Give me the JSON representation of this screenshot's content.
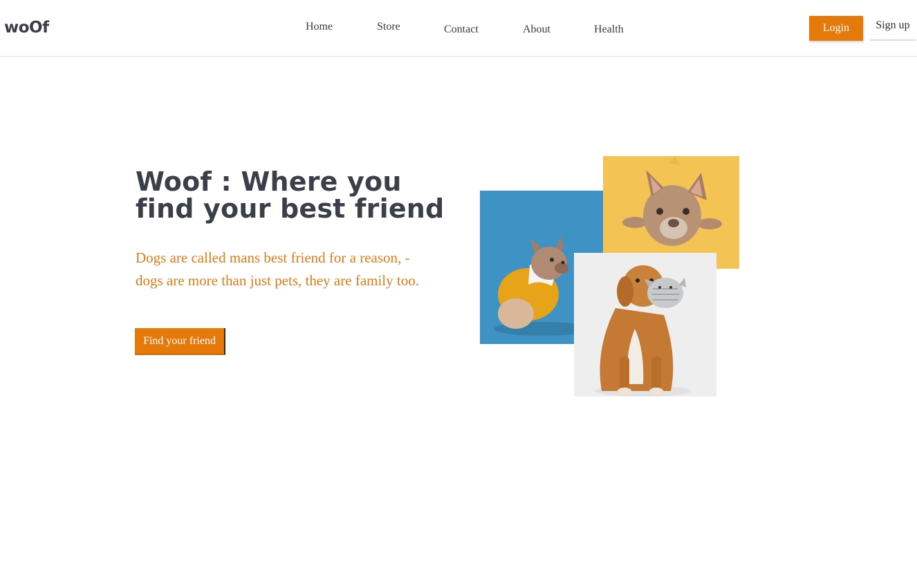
{
  "brand": {
    "logo_text": "woOf"
  },
  "nav": {
    "items": [
      {
        "label": "Home"
      },
      {
        "label": "Store"
      },
      {
        "label": "Contact"
      },
      {
        "label": "About"
      },
      {
        "label": "Health"
      }
    ]
  },
  "auth": {
    "login_label": "Login",
    "signup_label": "Sign up"
  },
  "hero": {
    "title": "Woof : Where you find your best friend",
    "description": "Dogs are called mans best friend for a reason, - dogs are more than just pets, they are family too.",
    "cta_label": "Find your friend"
  },
  "colors": {
    "accent": "#e57a0a",
    "heading": "#3b4048",
    "description": "#e07b16",
    "photo_blue_bg": "#3f93c4",
    "photo_yellow_bg": "#f3c453",
    "photo_white_bg": "#eeeeee"
  }
}
